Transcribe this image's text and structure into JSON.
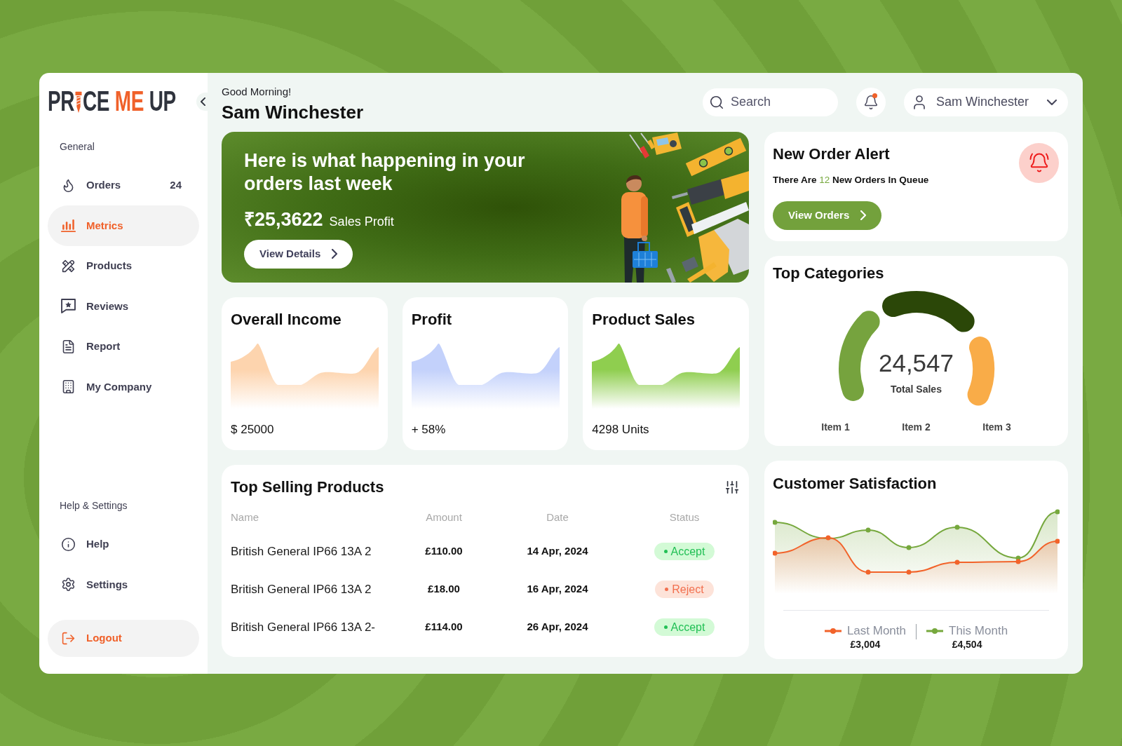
{
  "logo": {
    "prefix": "PR",
    "suffix": "CE",
    "accent": "ME",
    "last": "UP"
  },
  "sidebar": {
    "sections": [
      {
        "heading": "General",
        "items": [
          {
            "label": "Orders",
            "count": "24",
            "selected": false
          },
          {
            "label": "Metrics",
            "selected": true
          },
          {
            "label": "Products",
            "selected": false
          },
          {
            "label": "Reviews",
            "selected": false
          },
          {
            "label": "Report",
            "selected": false
          },
          {
            "label": "My Company",
            "selected": false
          }
        ]
      },
      {
        "heading": "Help & Settings",
        "items": [
          {
            "label": "Help",
            "selected": false
          },
          {
            "label": "Settings",
            "selected": false
          }
        ]
      }
    ],
    "logout": "Logout"
  },
  "header": {
    "greeting": "Good Morning!",
    "name": "Sam Winchester",
    "search": {
      "placeholder": "Search"
    },
    "notifications": {
      "unread": true
    },
    "user": "Sam Winchester"
  },
  "banner": {
    "title": "Here is what happening in your orders last week",
    "amount": "₹25,3622",
    "amount_label": "Sales Profit",
    "button": "View Details"
  },
  "stat_cards": [
    {
      "title": "Overall Income",
      "value": "$ 25000",
      "color": "#fdd4ae"
    },
    {
      "title": "Profit",
      "value": "+ 58%",
      "color": "#c3d1fb"
    },
    {
      "title": "Product Sales",
      "value": "4298 Units",
      "color": "#8fce4f"
    }
  ],
  "top_selling": {
    "title": "Top Selling Products",
    "columns": [
      "Name",
      "Amount",
      "Date",
      "Status"
    ],
    "rows": [
      {
        "name": "British General IP66 13A 2",
        "amount": "£110.00",
        "date": "14 Apr, 2024",
        "status": {
          "label": "Accept",
          "kind": "accept"
        }
      },
      {
        "name": "British General IP66 13A 2",
        "amount": "£18.00",
        "date": "16 Apr, 2024",
        "status": {
          "label": "Reject",
          "kind": "reject"
        }
      },
      {
        "name": "British General IP66 13A 2-",
        "amount": "£114.00",
        "date": "26 Apr, 2024",
        "status": {
          "label": "Accept",
          "kind": "accept"
        }
      }
    ]
  },
  "order_alert": {
    "title": "New Order Alert",
    "message_start": "There Are",
    "count": "12",
    "message_end": "New Orders In Queue",
    "button": "View Orders"
  },
  "top_categories": {
    "title": "Top Categories",
    "total": "24,547",
    "total_label": "Total Sales",
    "items": [
      {
        "label": "Item 1",
        "color": "#76a33e"
      },
      {
        "label": "Item 2",
        "color": "#2b4708"
      },
      {
        "label": "Item 3",
        "color": "#f9ac48"
      }
    ]
  },
  "customer_satisfaction": {
    "title": "Customer Satisfaction",
    "series": [
      {
        "name": "Last Month",
        "total": "£3,004",
        "color": "#f2632a"
      },
      {
        "name": "This Month",
        "total": "£4,504",
        "color": "#76a83d"
      }
    ]
  }
}
